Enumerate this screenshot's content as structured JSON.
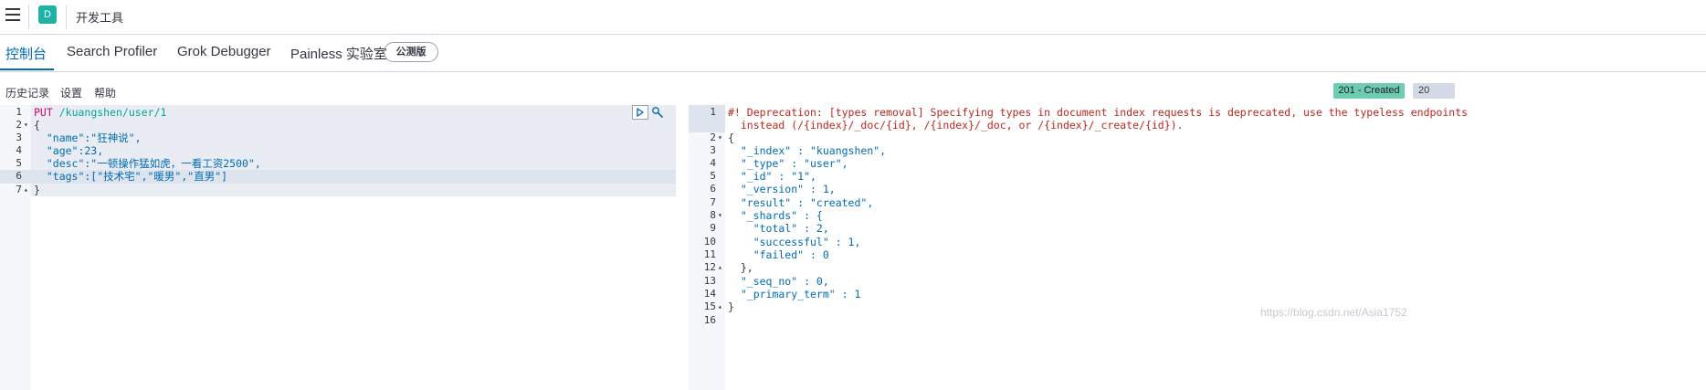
{
  "header": {
    "space_initial": "D",
    "app_title": "开发工具"
  },
  "tabs": [
    {
      "label": "控制台",
      "active": true
    },
    {
      "label": "Search Profiler"
    },
    {
      "label": "Grok Debugger"
    },
    {
      "label": "Painless 实验室"
    }
  ],
  "beta_badge": "公测版",
  "subnav": {
    "history": "历史记录",
    "settings": "设置",
    "help": "帮助"
  },
  "response_status": {
    "status": "201 - Created",
    "time": "20",
    "status_color": "#6dccb1"
  },
  "request": {
    "line_numbers": [
      "1",
      "2",
      "3",
      "4",
      "5",
      "6",
      "7"
    ],
    "method": "PUT",
    "url": "/kuangshen/user/1",
    "lines": [
      "{",
      "  \"name\":\"狂神说\",",
      "  \"age\":23,",
      "  \"desc\":\"一顿操作猛如虎，一看工资2500\",",
      "  \"tags\":[\"技术宅\",\"暖男\",\"直男\"]",
      "}"
    ]
  },
  "response": {
    "line_numbers": [
      "1",
      "2",
      "3",
      "4",
      "5",
      "6",
      "7",
      "8",
      "9",
      "10",
      "11",
      "12",
      "13",
      "14",
      "15",
      "16"
    ],
    "warning_line1": "#! Deprecation: [types removal] Specifying types in document index requests is deprecated, use the typeless endpoints",
    "warning_line2": "  instead (/{index}/_doc/{id}, /{index}/_doc, or /{index}/_create/{id}).",
    "lines": [
      "{",
      "  \"_index\" : \"kuangshen\",",
      "  \"_type\" : \"user\",",
      "  \"_id\" : \"1\",",
      "  \"_version\" : 1,",
      "  \"result\" : \"created\",",
      "  \"_shards\" : {",
      "    \"total\" : 2,",
      "    \"successful\" : 1,",
      "    \"failed\" : 0",
      "  },",
      "  \"_seq_no\" : 0,",
      "  \"_primary_term\" : 1",
      "}",
      ""
    ]
  },
  "watermark": "https://blog.csdn.net/Asia1752",
  "icons": {
    "menu": "hamburger-icon",
    "run": "play-icon",
    "settings": "wrench-icon"
  }
}
